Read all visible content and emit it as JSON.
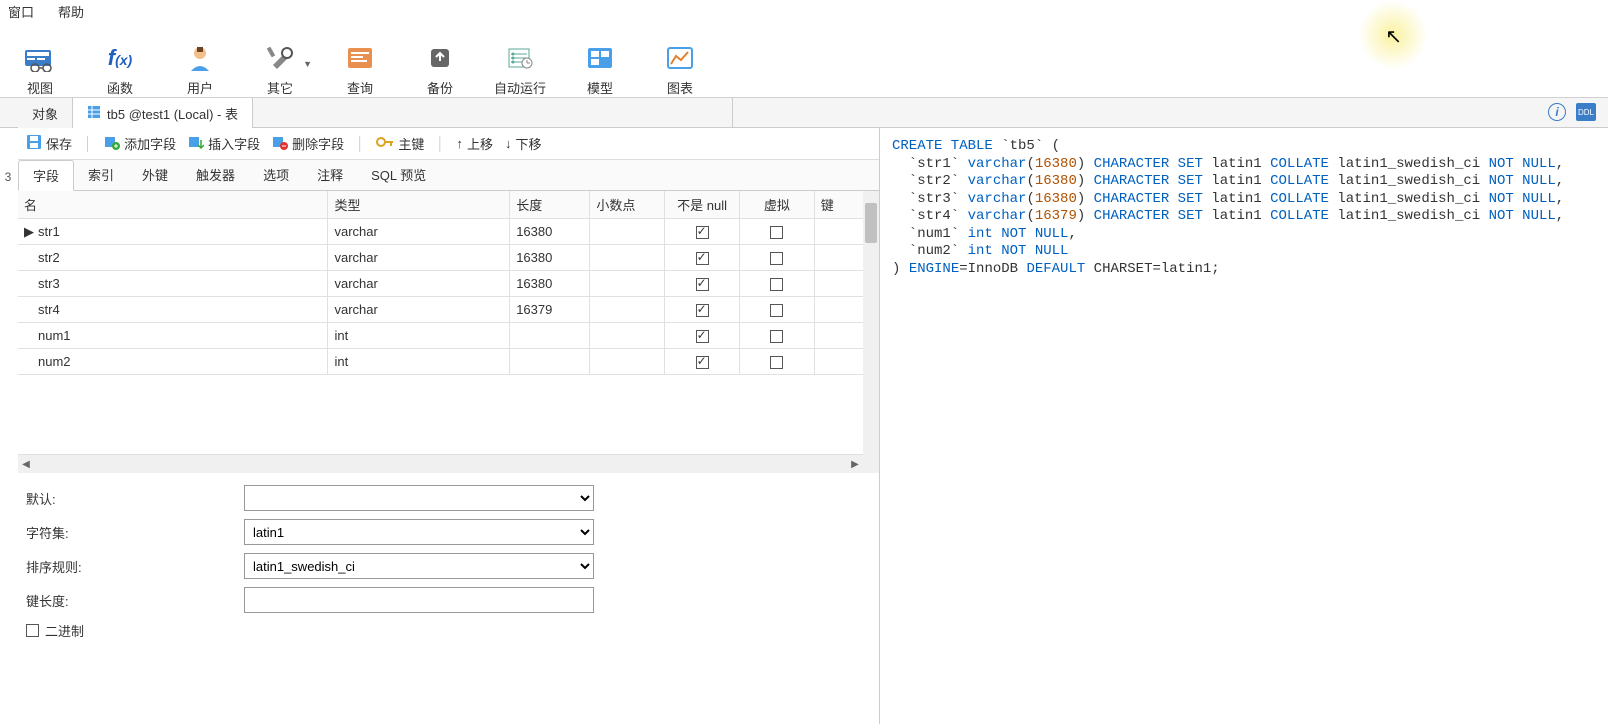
{
  "menu": {
    "window": "窗口",
    "help": "帮助"
  },
  "toolbar": [
    {
      "label": "视图",
      "icon": "view"
    },
    {
      "label": "函数",
      "icon": "fx"
    },
    {
      "label": "用户",
      "icon": "user"
    },
    {
      "label": "其它",
      "icon": "other",
      "dropdown": true
    },
    {
      "label": "查询",
      "icon": "query"
    },
    {
      "label": "备份",
      "icon": "backup"
    },
    {
      "label": "自动运行",
      "icon": "autorun"
    },
    {
      "label": "模型",
      "icon": "model"
    },
    {
      "label": "图表",
      "icon": "chart"
    }
  ],
  "tabs": {
    "object": "对象",
    "active": "tb5 @test1 (Local) - 表"
  },
  "sidebar_num": "3",
  "actions": {
    "save": "保存",
    "add_field": "添加字段",
    "insert_field": "插入字段",
    "delete_field": "删除字段",
    "primary_key": "主键",
    "move_up": "上移",
    "move_down": "下移"
  },
  "sub_tabs": [
    "字段",
    "索引",
    "外键",
    "触发器",
    "选项",
    "注释",
    "SQL 预览"
  ],
  "columns": {
    "name": "名",
    "type": "类型",
    "length": "长度",
    "decimal": "小数点",
    "not_null": "不是 null",
    "virtual": "虚拟",
    "key": "键"
  },
  "rows": [
    {
      "name": "str1",
      "type": "varchar",
      "length": "16380",
      "not_null": true,
      "virtual": false,
      "current": true
    },
    {
      "name": "str2",
      "type": "varchar",
      "length": "16380",
      "not_null": true,
      "virtual": false
    },
    {
      "name": "str3",
      "type": "varchar",
      "length": "16380",
      "not_null": true,
      "virtual": false
    },
    {
      "name": "str4",
      "type": "varchar",
      "length": "16379",
      "not_null": true,
      "virtual": false
    },
    {
      "name": "num1",
      "type": "int",
      "length": "",
      "not_null": true,
      "virtual": false
    },
    {
      "name": "num2",
      "type": "int",
      "length": "",
      "not_null": true,
      "virtual": false
    }
  ],
  "props": {
    "default_label": "默认:",
    "default_value": "",
    "charset_label": "字符集:",
    "charset_value": "latin1",
    "collation_label": "排序规则:",
    "collation_value": "latin1_swedish_ci",
    "keylen_label": "键长度:",
    "binary_label": "二进制"
  },
  "sql": {
    "create": "CREATE TABLE",
    "table": "`tb5`",
    "cols": [
      {
        "name": "`str1`",
        "type": "varchar",
        "len": "16380",
        "tail": "CHARACTER SET latin1 COLLATE latin1_swedish_ci NOT NULL,"
      },
      {
        "name": "`str2`",
        "type": "varchar",
        "len": "16380",
        "tail": "CHARACTER SET latin1 COLLATE latin1_swedish_ci NOT NULL,"
      },
      {
        "name": "`str3`",
        "type": "varchar",
        "len": "16380",
        "tail": "CHARACTER SET latin1 COLLATE latin1_swedish_ci NOT NULL,"
      },
      {
        "name": "`str4`",
        "type": "varchar",
        "len": "16379",
        "tail": "CHARACTER SET latin1 COLLATE latin1_swedish_ci NOT NULL,"
      },
      {
        "name": "`num1`",
        "type": "int",
        "len": "",
        "tail": "NOT NULL,"
      },
      {
        "name": "`num2`",
        "type": "int",
        "len": "",
        "tail": "NOT NULL"
      }
    ],
    "engine_line": ") ENGINE=InnoDB DEFAULT CHARSET=latin1;",
    "kw_charset": "CHARACTER SET",
    "kw_collate": "COLLATE",
    "kw_notnull": "NOT NULL",
    "kw_engine": "ENGINE",
    "kw_default": "DEFAULT"
  },
  "right_icons": {
    "info": "i",
    "ddl": "DDL"
  }
}
